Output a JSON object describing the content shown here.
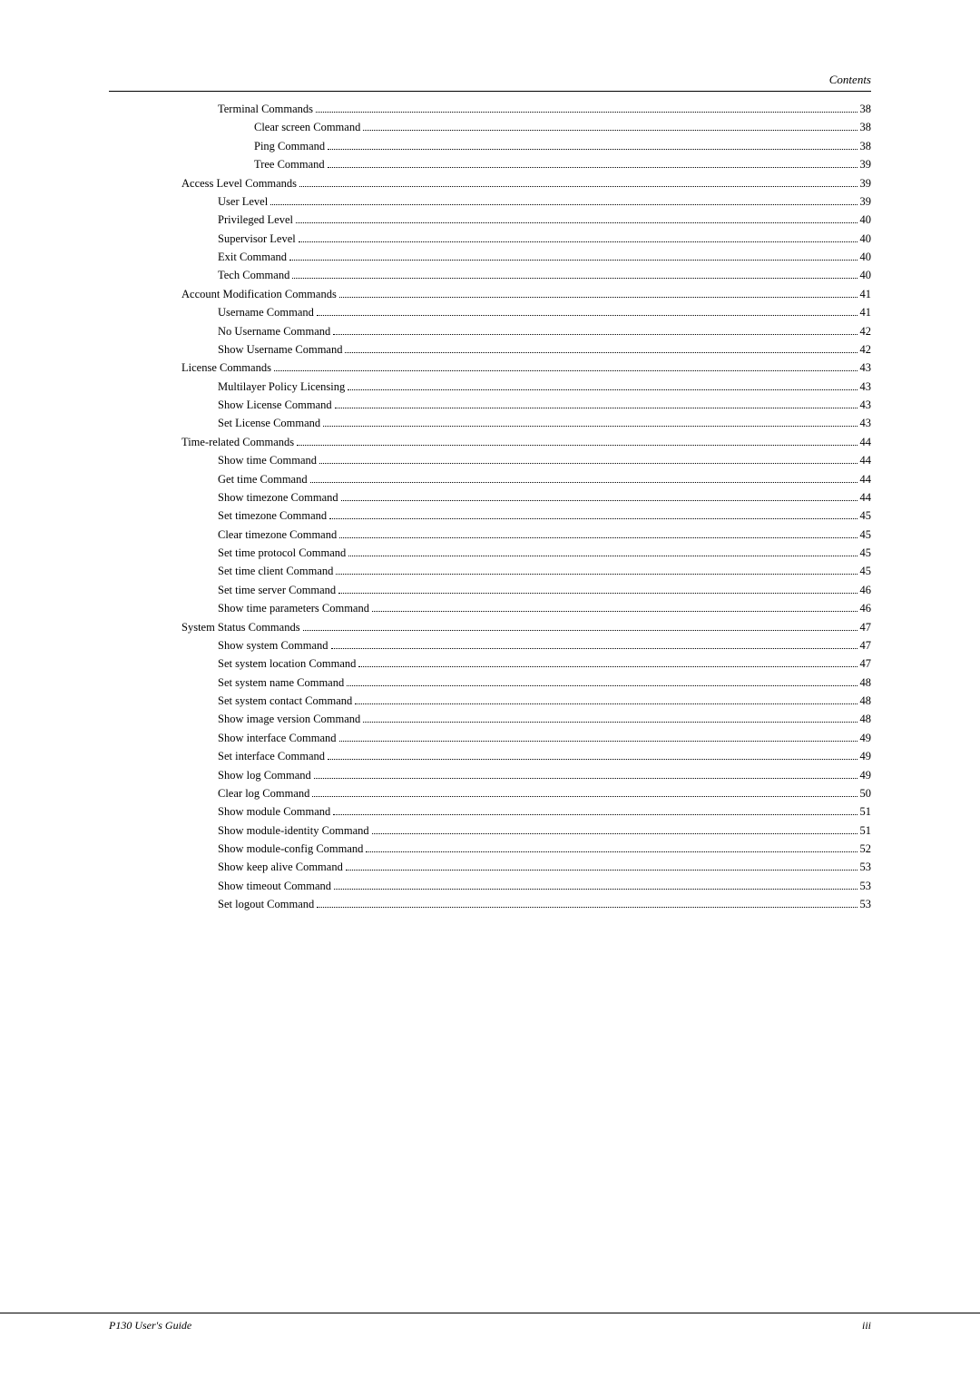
{
  "header": {
    "title": "Contents"
  },
  "footer": {
    "left": "P130 User's Guide",
    "right": "iii"
  },
  "toc": {
    "entries": [
      {
        "level": 2,
        "text": "Terminal Commands",
        "page": "38"
      },
      {
        "level": 3,
        "text": "Clear screen Command",
        "page": "38"
      },
      {
        "level": 3,
        "text": "Ping Command",
        "page": "38"
      },
      {
        "level": 3,
        "text": "Tree Command",
        "page": "39"
      },
      {
        "level": 1,
        "text": "Access Level Commands",
        "page": "39"
      },
      {
        "level": 2,
        "text": "User Level",
        "page": "39"
      },
      {
        "level": 2,
        "text": "Privileged Level",
        "page": "40"
      },
      {
        "level": 2,
        "text": "Supervisor Level",
        "page": "40"
      },
      {
        "level": 2,
        "text": "Exit Command",
        "page": "40"
      },
      {
        "level": 2,
        "text": "Tech Command",
        "page": "40"
      },
      {
        "level": 1,
        "text": "Account Modification Commands",
        "page": "41"
      },
      {
        "level": 2,
        "text": "Username Command",
        "page": "41"
      },
      {
        "level": 2,
        "text": "No Username Command",
        "page": "42"
      },
      {
        "level": 2,
        "text": "Show Username Command",
        "page": "42"
      },
      {
        "level": 1,
        "text": "License Commands",
        "page": "43"
      },
      {
        "level": 2,
        "text": "Multilayer Policy Licensing",
        "page": "43"
      },
      {
        "level": 2,
        "text": "Show License Command",
        "page": "43"
      },
      {
        "level": 2,
        "text": "Set License Command",
        "page": "43"
      },
      {
        "level": 1,
        "text": "Time-related Commands",
        "page": "44"
      },
      {
        "level": 2,
        "text": "Show time Command",
        "page": "44"
      },
      {
        "level": 2,
        "text": "Get time Command",
        "page": "44"
      },
      {
        "level": 2,
        "text": "Show timezone Command",
        "page": "44"
      },
      {
        "level": 2,
        "text": "Set timezone Command",
        "page": "45"
      },
      {
        "level": 2,
        "text": "Clear timezone Command",
        "page": "45"
      },
      {
        "level": 2,
        "text": "Set time protocol Command",
        "page": "45"
      },
      {
        "level": 2,
        "text": "Set time client Command",
        "page": "45"
      },
      {
        "level": 2,
        "text": "Set time server Command",
        "page": "46"
      },
      {
        "level": 2,
        "text": "Show time parameters Command",
        "page": "46"
      },
      {
        "level": 1,
        "text": "System Status Commands",
        "page": "47"
      },
      {
        "level": 2,
        "text": "Show system Command",
        "page": "47"
      },
      {
        "level": 2,
        "text": "Set system location Command",
        "page": "47"
      },
      {
        "level": 2,
        "text": "Set system name Command",
        "page": "48"
      },
      {
        "level": 2,
        "text": "Set system contact Command",
        "page": "48"
      },
      {
        "level": 2,
        "text": "Show image version Command",
        "page": "48"
      },
      {
        "level": 2,
        "text": "Show interface Command",
        "page": "49"
      },
      {
        "level": 2,
        "text": "Set interface Command",
        "page": "49"
      },
      {
        "level": 2,
        "text": "Show log Command",
        "page": "49"
      },
      {
        "level": 2,
        "text": "Clear log Command",
        "page": "50"
      },
      {
        "level": 2,
        "text": "Show module Command",
        "page": "51"
      },
      {
        "level": 2,
        "text": "Show module-identity Command",
        "page": "51"
      },
      {
        "level": 2,
        "text": "Show module-config Command",
        "page": "52"
      },
      {
        "level": 2,
        "text": "Show keep alive Command",
        "page": "53"
      },
      {
        "level": 2,
        "text": "Show timeout Command",
        "page": "53"
      },
      {
        "level": 2,
        "text": "Set logout Command",
        "page": "53"
      }
    ]
  }
}
